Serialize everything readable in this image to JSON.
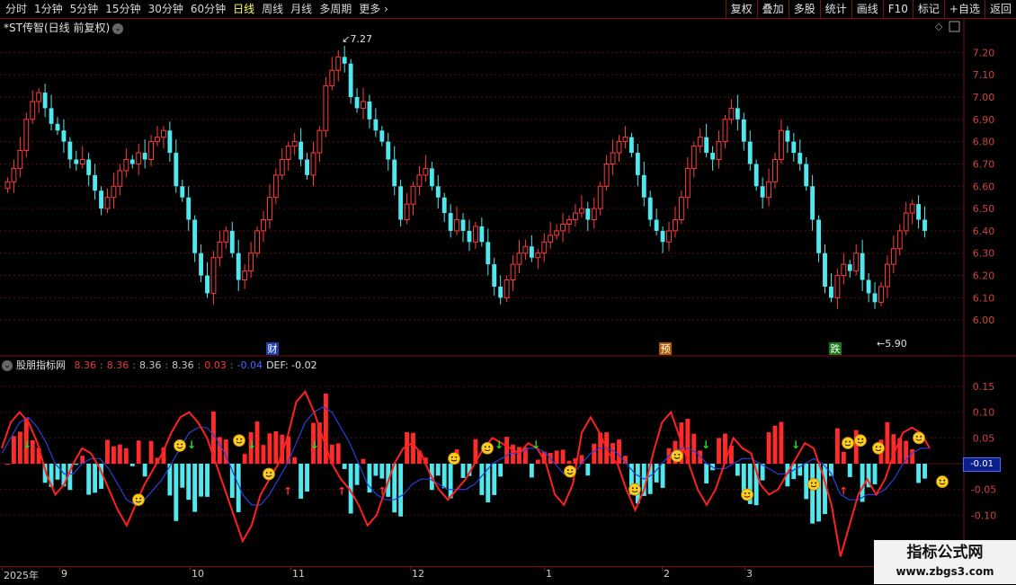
{
  "toolbar": {
    "periods": [
      "分时",
      "1分钟",
      "5分钟",
      "15分钟",
      "30分钟",
      "60分钟",
      "日线",
      "周线",
      "月线",
      "多周期",
      "更多"
    ],
    "active_period": "日线",
    "buttons": [
      "复权",
      "叠加",
      "多股",
      "统计",
      "画线",
      "F10",
      "标记",
      "+自选",
      "返回"
    ]
  },
  "stock": {
    "title": "*ST传智(日线 前复权)",
    "high_label": "7.27",
    "low_label": "5.90",
    "markers": [
      "财",
      "预",
      "跌"
    ]
  },
  "price_axis": {
    "ticks": [
      "7.20",
      "7.10",
      "7.00",
      "6.90",
      "6.80",
      "6.70",
      "6.60",
      "6.50",
      "6.40",
      "6.30",
      "6.20",
      "6.10",
      "6.00"
    ]
  },
  "indicator": {
    "name": "股朋指标网",
    "values": [
      {
        "text": "8.36",
        "color": "#e03c3c"
      },
      {
        "text": ":",
        "color": "#888888"
      },
      {
        "text": "8.36",
        "color": "#e03c3c"
      },
      {
        "text": ":",
        "color": "#888888"
      },
      {
        "text": "8.36",
        "color": "#c8c8c8"
      },
      {
        "text": ":",
        "color": "#888888"
      },
      {
        "text": "8.36",
        "color": "#c8c8c8"
      },
      {
        "text": ":",
        "color": "#888888"
      },
      {
        "text": "0.03",
        "color": "#ff3333"
      },
      {
        "text": ":",
        "color": "#888888"
      },
      {
        "text": "-0.04",
        "color": "#4466ff"
      },
      {
        "text": "DEF: -0.02",
        "color": "#e0e0e0"
      }
    ],
    "axis_ticks": [
      "0.15",
      "0.10",
      "0.05",
      "-0.05",
      "-0.10"
    ],
    "current_value": "-0.01"
  },
  "time_axis": {
    "labels": [
      "2025年",
      "9",
      "10",
      "11",
      "12",
      "1",
      "2",
      "3"
    ]
  },
  "watermark": {
    "title": "指标公式网",
    "url": "www.zbgs3.com"
  },
  "chart_data": {
    "type": "candlestick",
    "up_color": "#ff3b3b",
    "down_color": "#4ee8ee",
    "price_range": [
      5.9,
      7.27
    ],
    "candles_close": [
      6.62,
      6.68,
      6.76,
      6.9,
      6.98,
      7.02,
      6.95,
      6.88,
      6.85,
      6.8,
      6.72,
      6.7,
      6.72,
      6.65,
      6.58,
      6.5,
      6.55,
      6.6,
      6.67,
      6.72,
      6.7,
      6.75,
      6.72,
      6.8,
      6.82,
      6.85,
      6.75,
      6.6,
      6.55,
      6.45,
      6.3,
      6.2,
      6.12,
      6.28,
      6.35,
      6.4,
      6.3,
      6.18,
      6.22,
      6.3,
      6.4,
      6.45,
      6.55,
      6.65,
      6.72,
      6.78,
      6.8,
      6.72,
      6.65,
      6.75,
      6.85,
      7.05,
      7.12,
      7.18,
      7.15,
      7.0,
      6.95,
      6.98,
      6.9,
      6.85,
      6.8,
      6.72,
      6.6,
      6.45,
      6.52,
      6.6,
      6.65,
      6.68,
      6.6,
      6.55,
      6.48,
      6.4,
      6.45,
      6.4,
      6.35,
      6.42,
      6.35,
      6.25,
      6.15,
      6.1,
      6.18,
      6.25,
      6.3,
      6.33,
      6.28,
      6.3,
      6.35,
      6.38,
      6.4,
      6.43,
      6.45,
      6.48,
      6.5,
      6.45,
      6.5,
      6.6,
      6.7,
      6.75,
      6.8,
      6.82,
      6.75,
      6.65,
      6.55,
      6.45,
      6.4,
      6.35,
      6.4,
      6.45,
      6.55,
      6.68,
      6.78,
      6.82,
      6.75,
      6.72,
      6.8,
      6.9,
      6.95,
      6.9,
      6.8,
      6.7,
      6.6,
      6.55,
      6.62,
      6.72,
      6.85,
      6.8,
      6.75,
      6.7,
      6.6,
      6.45,
      6.3,
      6.15,
      6.1,
      6.2,
      6.25,
      6.22,
      6.3,
      6.18,
      6.12,
      6.08,
      6.15,
      6.25,
      6.32,
      6.4,
      6.48,
      6.52,
      6.45,
      6.4
    ],
    "dif_line": [
      0.03,
      0.08,
      0.1,
      0.08,
      0.04,
      -0.02,
      -0.06,
      -0.04,
      0.0,
      0.03,
      0.02,
      -0.01,
      -0.05,
      -0.09,
      -0.12,
      -0.08,
      -0.04,
      -0.01,
      0.02,
      0.06,
      0.09,
      0.1,
      0.08,
      0.05,
      0.0,
      -0.05,
      -0.1,
      -0.15,
      -0.12,
      -0.06,
      -0.03,
      0.0,
      0.05,
      0.12,
      0.14,
      0.1,
      0.05,
      0.0,
      -0.03,
      -0.05,
      -0.08,
      -0.12,
      -0.1,
      -0.05,
      0.0,
      0.03,
      0.04,
      0.02,
      -0.02,
      -0.05,
      -0.07,
      -0.05,
      -0.03,
      0.0,
      0.03,
      0.05,
      0.04,
      0.03,
      0.02,
      0.04,
      0.03,
      0.0,
      -0.06,
      -0.08,
      -0.04,
      0.06,
      0.09,
      0.06,
      0.02,
      0.0,
      -0.05,
      -0.09,
      -0.05,
      0.02,
      0.08,
      0.1,
      0.05,
      0.0,
      -0.05,
      -0.08,
      -0.05,
      0.0,
      0.05,
      0.03,
      0.02,
      -0.04,
      -0.06,
      -0.05,
      -0.02,
      0.01,
      0.04,
      0.03,
      -0.02,
      -0.08,
      -0.18,
      -0.12,
      -0.06,
      -0.03,
      -0.06,
      -0.03,
      0.02,
      0.06,
      0.07,
      0.06,
      0.03
    ],
    "dea_line": [
      0.02,
      0.05,
      0.08,
      0.09,
      0.07,
      0.04,
      0.0,
      -0.02,
      -0.02,
      0.0,
      0.01,
      0.01,
      -0.01,
      -0.04,
      -0.07,
      -0.08,
      -0.07,
      -0.05,
      -0.03,
      0.0,
      0.03,
      0.06,
      0.07,
      0.07,
      0.05,
      0.02,
      -0.02,
      -0.06,
      -0.08,
      -0.08,
      -0.06,
      -0.03,
      0.0,
      0.04,
      0.08,
      0.1,
      0.11,
      0.1,
      0.07,
      0.04,
      0.0,
      -0.04,
      -0.06,
      -0.07,
      -0.07,
      -0.06,
      -0.04,
      -0.03,
      -0.03,
      -0.04,
      -0.05,
      -0.05,
      -0.05,
      -0.04,
      -0.02,
      0.0,
      0.01,
      0.02,
      0.02,
      0.03,
      0.03,
      0.02,
      0.0,
      -0.02,
      -0.02,
      0.0,
      0.02,
      0.03,
      0.03,
      0.02,
      0.0,
      -0.02,
      -0.03,
      -0.02,
      0.0,
      0.02,
      0.03,
      0.03,
      0.02,
      0.0,
      -0.01,
      -0.01,
      0.0,
      0.01,
      0.01,
      0.0,
      -0.01,
      -0.02,
      -0.02,
      -0.01,
      0.0,
      0.01,
      0.0,
      -0.02,
      -0.06,
      -0.07,
      -0.07,
      -0.06,
      -0.06,
      -0.05,
      -0.03,
      0.0,
      0.02,
      0.03,
      0.03
    ]
  }
}
